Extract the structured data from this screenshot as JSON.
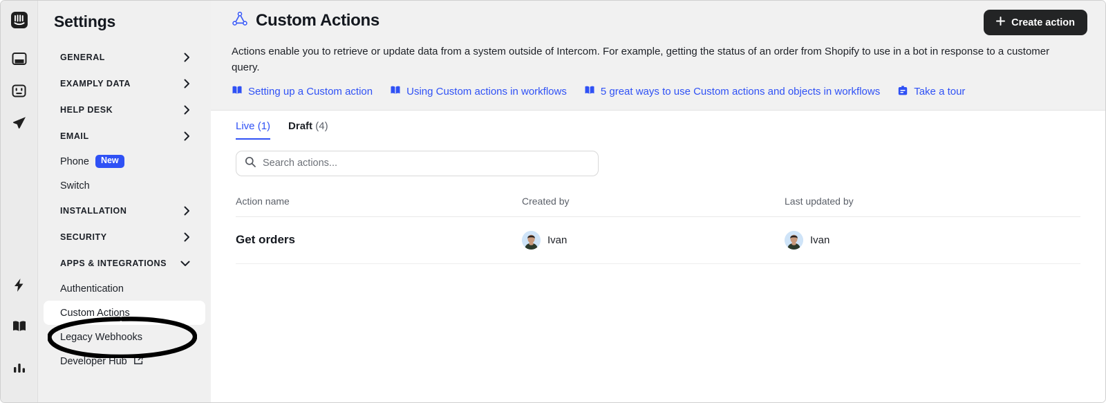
{
  "colors": {
    "accent": "#2f51f5",
    "button_bg": "#232425",
    "sidebar_bg": "#f0f0f0",
    "rail_bg": "#ebebeb",
    "header_bg": "#f1f1f1",
    "muted_text": "#5b6069"
  },
  "rail": {
    "top_icons": [
      {
        "name": "intercom-logo-icon"
      },
      {
        "name": "inbox-icon"
      },
      {
        "name": "tickets-icon"
      },
      {
        "name": "send-outbound-icon"
      }
    ],
    "bottom_icons": [
      {
        "name": "automation-lightning-icon"
      },
      {
        "name": "knowledge-book-icon"
      },
      {
        "name": "reports-bar-chart-icon"
      }
    ]
  },
  "sidebar": {
    "title": "Settings",
    "items": [
      {
        "label": "GENERAL",
        "type": "section",
        "icon": "chevron-right-icon"
      },
      {
        "label": "EXAMPLY DATA",
        "type": "section",
        "icon": "chevron-right-icon"
      },
      {
        "label": "HELP DESK",
        "type": "section",
        "icon": "chevron-right-icon"
      },
      {
        "label": "EMAIL",
        "type": "section",
        "icon": "chevron-right-icon"
      },
      {
        "label": "Phone",
        "type": "item",
        "badge": "New"
      },
      {
        "label": "Switch",
        "type": "item"
      },
      {
        "label": "INSTALLATION",
        "type": "section",
        "icon": "chevron-right-icon"
      },
      {
        "label": "SECURITY",
        "type": "section",
        "icon": "chevron-right-icon"
      },
      {
        "label": "APPS & INTEGRATIONS",
        "type": "section",
        "icon": "chevron-down-icon"
      },
      {
        "label": "Authentication",
        "type": "item"
      },
      {
        "label": "Custom Actions",
        "type": "item",
        "selected": true
      },
      {
        "label": "Legacy Webhooks",
        "type": "item"
      },
      {
        "label": "Developer Hub",
        "type": "item",
        "icon": "external-link-icon"
      }
    ],
    "annotation": "circle-highlight-custom-actions"
  },
  "header": {
    "icon": "custom-actions-graph-icon",
    "title": "Custom Actions",
    "create_button": {
      "label": "Create action",
      "icon": "plus-icon"
    },
    "description": "Actions enable you to retrieve or update data from a system outside of Intercom. For example, getting the status of an order from Shopify to use in a bot in response to a customer query.",
    "links": [
      {
        "label": "Setting up a Custom action",
        "icon": "book-icon"
      },
      {
        "label": "Using Custom actions in workflows",
        "icon": "book-icon"
      },
      {
        "label": "5 great ways to use Custom actions and objects in workflows",
        "icon": "book-icon"
      },
      {
        "label": "Take a tour",
        "icon": "tour-clipboard-icon"
      }
    ]
  },
  "tabs": [
    {
      "label": "Live",
      "count": "(1)",
      "active": true
    },
    {
      "label": "Draft",
      "count": "(4)",
      "active": false
    }
  ],
  "search": {
    "placeholder": "Search actions...",
    "value": "",
    "icon": "search-icon"
  },
  "table": {
    "columns": [
      "Action name",
      "Created by",
      "Last updated by"
    ],
    "rows": [
      {
        "action_name": "Get orders",
        "created_by": "Ivan",
        "last_updated_by": "Ivan"
      }
    ]
  }
}
